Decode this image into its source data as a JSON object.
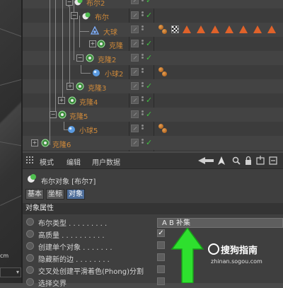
{
  "object_manager": {
    "rows": [
      {
        "label": "布尔2",
        "icon": "boolean-icon"
      },
      {
        "label": "布尔",
        "icon": "boolean-icon"
      },
      {
        "label": "大球",
        "icon": "null-icon"
      },
      {
        "label": "克隆",
        "icon": "cloner-icon"
      },
      {
        "label": "克隆2",
        "icon": "cloner-icon"
      },
      {
        "label": "小球2",
        "icon": "sphere-icon"
      },
      {
        "label": "克隆3",
        "icon": "cloner-icon"
      },
      {
        "label": "克隆4",
        "icon": "cloner-icon"
      },
      {
        "label": "克隆5",
        "icon": "cloner-icon"
      },
      {
        "label": "小球5",
        "icon": "sphere-icon"
      },
      {
        "label": "克隆6",
        "icon": "cloner-icon"
      }
    ],
    "colors": {
      "name": "#d08a3a",
      "check": "#3fbf3f",
      "tag_triangle": "#e0622a"
    }
  },
  "attribute_manager": {
    "menu": [
      "模式",
      "编辑",
      "用户数据"
    ],
    "title": "布尔对象 [布尔7]",
    "tabs": [
      {
        "label": "基本",
        "active": false
      },
      {
        "label": "坐标",
        "active": false
      },
      {
        "label": "对象",
        "active": true
      }
    ],
    "section": "对象属性",
    "properties": [
      {
        "label": "布尔类型 . . . . . . . . .",
        "type": "dropdown",
        "value": "A B 补集"
      },
      {
        "label": "高质量 . . . . . . . . . .",
        "type": "checkbox",
        "checked": true
      },
      {
        "label": "创建单个对象 . . . . . . .",
        "type": "checkbox",
        "checked": false
      },
      {
        "label": "隐藏新的边 . . . . . . . .",
        "type": "checkbox",
        "checked": false
      },
      {
        "label": "交叉处创建平滑着色(Phong)分割",
        "type": "checkbox",
        "checked": false
      },
      {
        "label": "选择交界",
        "type": "checkbox",
        "checked": false
      }
    ],
    "accent": "#4e6e9a"
  },
  "watermark": {
    "brand": "搜狗指南",
    "url": "zhinan.sogou.com"
  },
  "viewport": {
    "partial_text": "cm"
  }
}
